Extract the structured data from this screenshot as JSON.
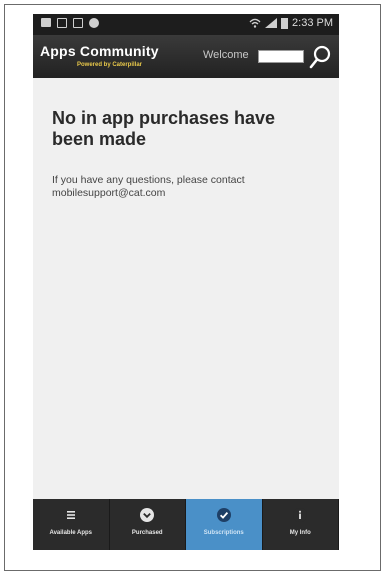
{
  "status_bar": {
    "time": "2:33 PM"
  },
  "header": {
    "app_title": "Apps Community",
    "app_subtitle": "Powered by Caterpillar",
    "welcome_label": "Welcome"
  },
  "main": {
    "headline": "No in app purchases have been made",
    "message": "If you have any questions, please contact mobilesupport@cat.com"
  },
  "bottom_nav": {
    "items": [
      {
        "label": "Available Apps",
        "icon": "list-icon",
        "active": false
      },
      {
        "label": "Purchased",
        "icon": "chevron-down-icon",
        "active": false
      },
      {
        "label": "Subscriptions",
        "icon": "check-icon",
        "active": true
      },
      {
        "label": "My Info",
        "icon": "info-icon",
        "active": false
      }
    ]
  },
  "colors": {
    "header_bg": "#2b2b2b",
    "active_tab": "#4a90c8",
    "subtitle": "#e8c84a",
    "content_bg": "#f0f0f0"
  }
}
